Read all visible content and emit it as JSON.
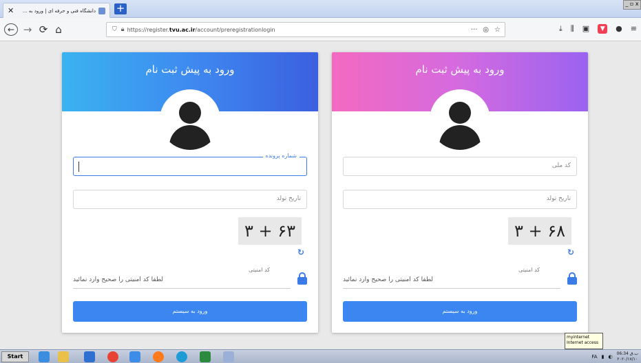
{
  "browser": {
    "tab_title": "دانشگاه فنی و حرفه ای | ورود به ...",
    "tab_close": "✕",
    "new_tab": "+",
    "url_prefix": "https://register.",
    "url_domain": "tvu.ac.ir",
    "url_suffix": "/account/preregistrationlogin",
    "url_more": "···",
    "window_controls": "_ ▫ x"
  },
  "left_card": {
    "title": "ورود به پیش ثبت نام",
    "field1_label": "شماره پرونده",
    "field2_placeholder": "تاریخ تولد",
    "captcha": "٣ + ۶٣",
    "security_label": "کد امنیتی",
    "security_placeholder": "لطفا کد امنیتی را صحیح وارد نمائید",
    "submit": "ورود به سیستم"
  },
  "right_card": {
    "title": "ورود به پیش ثبت نام",
    "field1_placeholder": "کد ملی",
    "field2_placeholder": "تاریخ تولد",
    "captcha": "٣ + ۶٨",
    "security_label": "کد امنیتی",
    "security_placeholder": "لطفا کد امنیتی را صحیح وارد نمائید",
    "submit": "ورود به سیستم"
  },
  "taskbar": {
    "start": "Start",
    "lang": "FA",
    "time": "06:34 ب.ق",
    "date": "۲۰۲۰/۱۷/۱۰",
    "tooltip_line1": "myinternet",
    "tooltip_line2": "Internet access"
  }
}
